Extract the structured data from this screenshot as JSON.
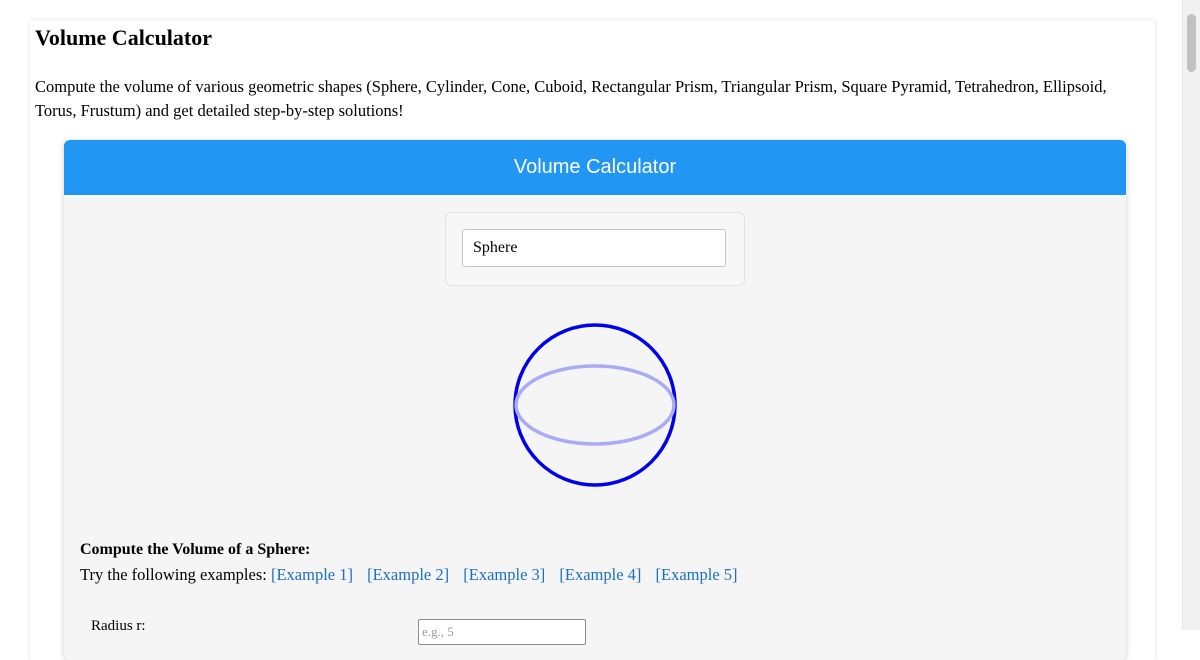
{
  "page": {
    "title": "Volume Calculator",
    "intro": "Compute the volume of various geometric shapes (Sphere, Cylinder, Cone, Cuboid, Rectangular Prism, Triangular Prism, Square Pyramid, Tetrahedron, Ellipsoid, Torus, Frustum) and get detailed step-by-step solutions!"
  },
  "calculator": {
    "header": "Volume Calculator",
    "header_color": "#2196f3",
    "shape_select": {
      "selected": "Sphere"
    },
    "figure": {
      "shape": "sphere",
      "outline_color": "#0000ee",
      "equator_color": "#aaaaf5"
    },
    "compute_title": "Compute the Volume of a Sphere:",
    "examples_prefix": "Try the following examples:",
    "examples": [
      "[Example 1]",
      "[Example 2]",
      "[Example 3]",
      "[Example 4]",
      "[Example 5]"
    ],
    "radius": {
      "label": "Radius r:",
      "placeholder": "e.g., 5"
    }
  }
}
